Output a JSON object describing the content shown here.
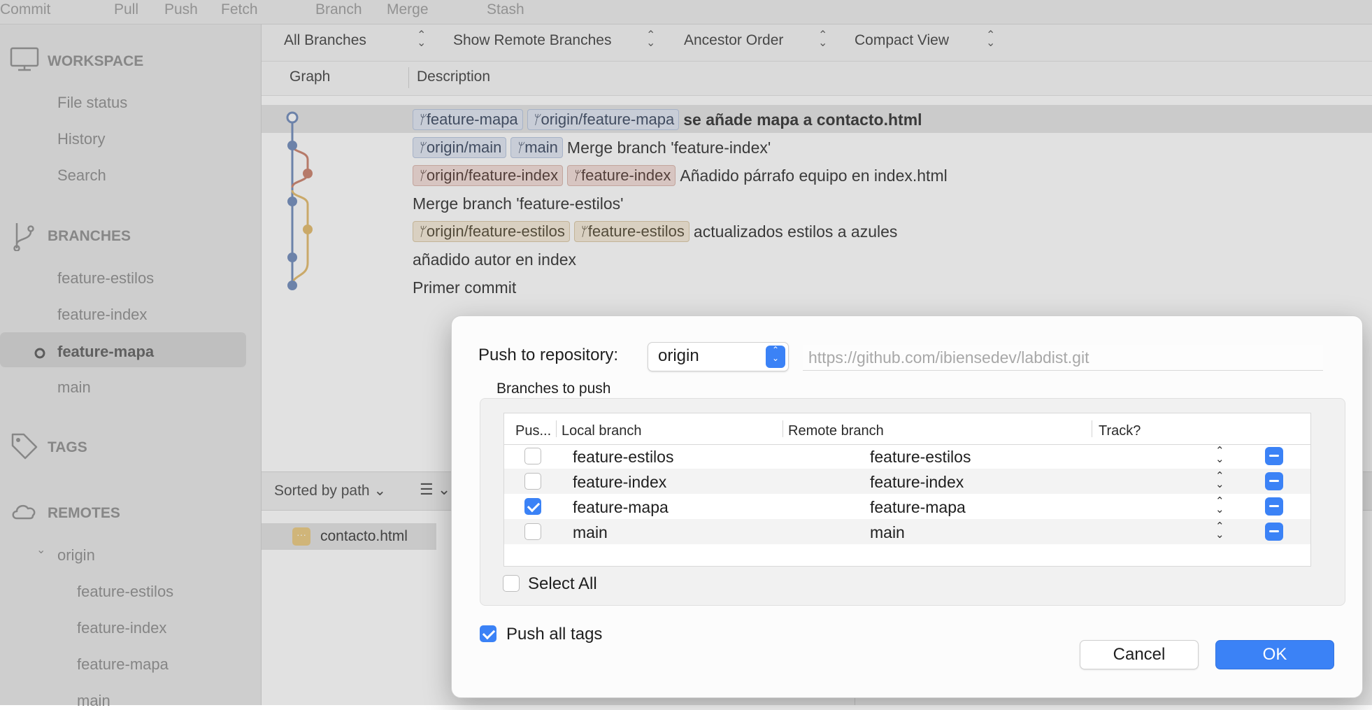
{
  "toolbar": {
    "items": [
      "Commit",
      "Pull",
      "Push",
      "Fetch",
      "Branch",
      "Merge",
      "Stash"
    ]
  },
  "sidebar": {
    "workspace": {
      "title": "WORKSPACE",
      "items": [
        "File status",
        "History",
        "Search"
      ]
    },
    "branches": {
      "title": "BRANCHES",
      "items": [
        "feature-estilos",
        "feature-index",
        "feature-mapa",
        "main"
      ],
      "current": "feature-mapa"
    },
    "tags": {
      "title": "TAGS"
    },
    "remotes": {
      "title": "REMOTES",
      "origin": "origin",
      "items": [
        "feature-estilos",
        "feature-index",
        "feature-mapa",
        "main"
      ]
    }
  },
  "filters": {
    "branches": "All Branches",
    "remote": "Show Remote Branches",
    "order": "Ancestor Order",
    "view": "Compact View"
  },
  "columns": {
    "graph": "Graph",
    "description": "Description"
  },
  "commits": [
    {
      "tags": [
        {
          "label": "feature-mapa",
          "color": "blue"
        },
        {
          "label": "origin/feature-mapa",
          "color": "blue"
        }
      ],
      "message": "se añade mapa a contacto.html"
    },
    {
      "tags": [
        {
          "label": "origin/main",
          "color": "blue"
        },
        {
          "label": "main",
          "color": "blue"
        }
      ],
      "message": "Merge branch 'feature-index'"
    },
    {
      "tags": [
        {
          "label": "origin/feature-index",
          "color": "red"
        },
        {
          "label": "feature-index",
          "color": "red"
        }
      ],
      "message": "Añadido párrafo equipo en index.html"
    },
    {
      "tags": [],
      "message": "Merge branch 'feature-estilos'"
    },
    {
      "tags": [
        {
          "label": "origin/feature-estilos",
          "color": "yellow"
        },
        {
          "label": "feature-estilos",
          "color": "yellow"
        }
      ],
      "message": "actualizados estilos a azules"
    },
    {
      "tags": [],
      "message": "añadido autor en index"
    },
    {
      "tags": [],
      "message": "Primer commit"
    }
  ],
  "lower": {
    "sort": "Sorted by path",
    "file": "contacto.html"
  },
  "dialog": {
    "repo_label": "Push to repository:",
    "repo_value": "origin",
    "repo_url": "https://github.com/ibiensedev/labdist.git",
    "group_title": "Branches to push",
    "headers": {
      "push": "Pus...",
      "local": "Local branch",
      "remote": "Remote branch",
      "track": "Track?"
    },
    "rows": [
      {
        "push": false,
        "local": "feature-estilos",
        "remote": "feature-estilos"
      },
      {
        "push": false,
        "local": "feature-index",
        "remote": "feature-index"
      },
      {
        "push": true,
        "local": "feature-mapa",
        "remote": "feature-mapa"
      },
      {
        "push": false,
        "local": "main",
        "remote": "main"
      }
    ],
    "select_all": "Select All",
    "select_all_checked": false,
    "push_tags": "Push all tags",
    "push_tags_checked": true,
    "cancel": "Cancel",
    "ok": "OK"
  },
  "colors": {
    "accent": "#3b82f6",
    "graph_main": "#6a86b8",
    "graph_index": "#c87c66",
    "graph_estilos": "#e2b866"
  }
}
